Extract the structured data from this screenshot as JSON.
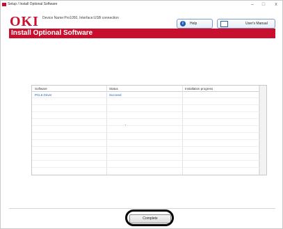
{
  "window": {
    "title": "Setup / Install Optional Software",
    "controls": {
      "minimize": "–",
      "maximize": "□",
      "close": "x"
    }
  },
  "header": {
    "logo": "OKI",
    "device_info": "Device Name:Pro1050, Interface:USB connection",
    "help_label": "Help",
    "manual_label": "User's Manual"
  },
  "banner": {
    "title": "Install Optional Software"
  },
  "table": {
    "columns": [
      "Software",
      "Status",
      "Installation progress"
    ],
    "rows": [
      {
        "software": "PCL6 Driver",
        "status": "Succeed",
        "progress": ""
      }
    ]
  },
  "footer": {
    "complete_label": "Complete"
  },
  "colors": {
    "brand_red": "#c8102e",
    "link_blue": "#1f5fb4"
  }
}
